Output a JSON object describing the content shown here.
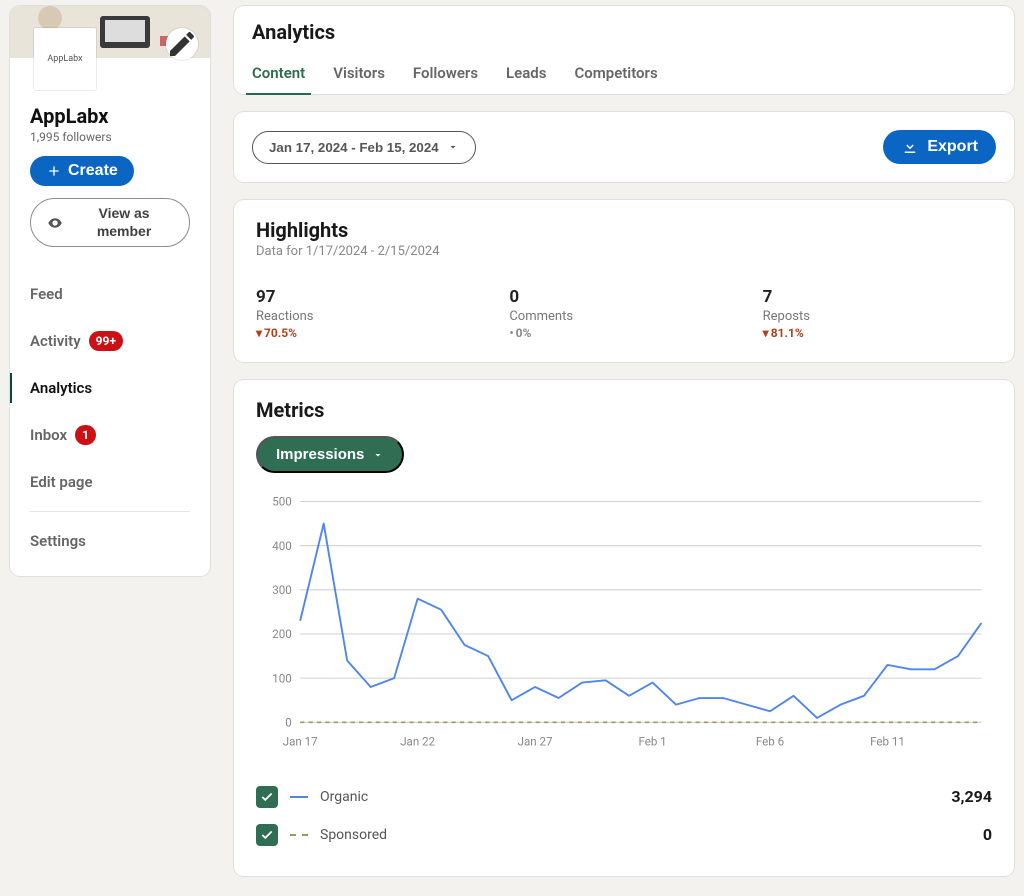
{
  "sidebar": {
    "page_name": "AppLabx",
    "followers_line": "1,995 followers",
    "avatar_text": "AppLabx",
    "create_label": "Create",
    "view_as_label": "View as member",
    "items": [
      {
        "label": "Feed"
      },
      {
        "label": "Activity",
        "badge": "99+"
      },
      {
        "label": "Analytics",
        "active": true
      },
      {
        "label": "Inbox",
        "badge": "1"
      },
      {
        "label": "Edit page"
      }
    ],
    "settings_label": "Settings"
  },
  "header": {
    "title": "Analytics",
    "tabs": [
      {
        "label": "Content",
        "active": true
      },
      {
        "label": "Visitors"
      },
      {
        "label": "Followers"
      },
      {
        "label": "Leads"
      },
      {
        "label": "Competitors"
      }
    ]
  },
  "date_range": "Jan 17, 2024 - Feb 15, 2024",
  "export_label": "Export",
  "highlights": {
    "title": "Highlights",
    "sub": "Data for 1/17/2024 - 2/15/2024",
    "items": [
      {
        "value": "97",
        "label": "Reactions",
        "trend": "70.5%",
        "dir": "down"
      },
      {
        "value": "0",
        "label": "Comments",
        "trend": "0%",
        "dir": "neutral"
      },
      {
        "value": "7",
        "label": "Reposts",
        "trend": "81.1%",
        "dir": "down"
      }
    ]
  },
  "metrics": {
    "title": "Metrics",
    "selector": "Impressions",
    "legend": [
      {
        "label": "Organic",
        "value": "3,294",
        "style": "solid"
      },
      {
        "label": "Sponsored",
        "value": "0",
        "style": "dashed"
      }
    ]
  },
  "chart_data": {
    "type": "line",
    "xlabel": "",
    "ylabel": "",
    "ylim": [
      0,
      500
    ],
    "y_ticks": [
      0,
      100,
      200,
      300,
      400,
      500
    ],
    "x_tick_labels": [
      "Jan 17",
      "Jan 22",
      "Jan 27",
      "Feb 1",
      "Feb 6",
      "Feb 11"
    ],
    "x_tick_indices": [
      0,
      5,
      10,
      15,
      20,
      25
    ],
    "dates": [
      "Jan 17",
      "Jan 18",
      "Jan 19",
      "Jan 20",
      "Jan 21",
      "Jan 22",
      "Jan 23",
      "Jan 24",
      "Jan 25",
      "Jan 26",
      "Jan 27",
      "Jan 28",
      "Jan 29",
      "Jan 30",
      "Jan 31",
      "Feb 1",
      "Feb 2",
      "Feb 3",
      "Feb 4",
      "Feb 5",
      "Feb 6",
      "Feb 7",
      "Feb 8",
      "Feb 9",
      "Feb 10",
      "Feb 11",
      "Feb 12",
      "Feb 13",
      "Feb 14",
      "Feb 15"
    ],
    "series": [
      {
        "name": "Organic",
        "values": [
          230,
          450,
          140,
          80,
          100,
          280,
          255,
          175,
          150,
          50,
          80,
          55,
          90,
          95,
          60,
          90,
          40,
          55,
          55,
          40,
          25,
          60,
          10,
          40,
          60,
          130,
          120,
          120,
          150,
          225
        ]
      },
      {
        "name": "Sponsored",
        "values": [
          0,
          0,
          0,
          0,
          0,
          0,
          0,
          0,
          0,
          0,
          0,
          0,
          0,
          0,
          0,
          0,
          0,
          0,
          0,
          0,
          0,
          0,
          0,
          0,
          0,
          0,
          0,
          0,
          0,
          0
        ]
      }
    ]
  }
}
